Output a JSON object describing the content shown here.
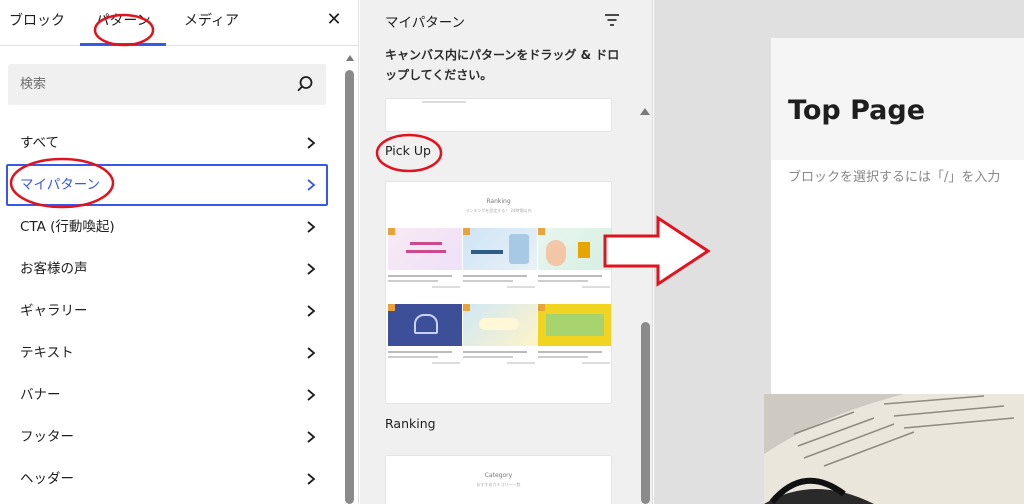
{
  "tabs": {
    "blocks": "ブロック",
    "patterns": "パターン",
    "media": "メディア",
    "close_icon": "close-icon"
  },
  "search": {
    "placeholder": "検索"
  },
  "categories": [
    {
      "label": "すべて"
    },
    {
      "label": "マイパターン"
    },
    {
      "label": "CTA (行動喚起)"
    },
    {
      "label": "お客様の声"
    },
    {
      "label": "ギャラリー"
    },
    {
      "label": "テキスト"
    },
    {
      "label": "バナー"
    },
    {
      "label": "フッター"
    },
    {
      "label": "ヘッダー"
    }
  ],
  "patterns_panel": {
    "title": "マイパターン",
    "hint": "キャンバス内にパターンをドラッグ & ドロップしてください。",
    "items": [
      {
        "label": "Pick Up"
      },
      {
        "label": "Ranking"
      }
    ],
    "ranking_preview": {
      "title": "Ranking",
      "subtitle": "ランキングを設定する！ 24時間以内"
    },
    "category_preview": {
      "title": "Category",
      "subtitle": "おすすめカテゴリー一覧"
    }
  },
  "editor": {
    "page_title": "Top Page",
    "placeholder": "ブロックを選択するには「/」を入力"
  },
  "colors": {
    "accent": "#3858e9",
    "annotation": "#e0141e"
  }
}
